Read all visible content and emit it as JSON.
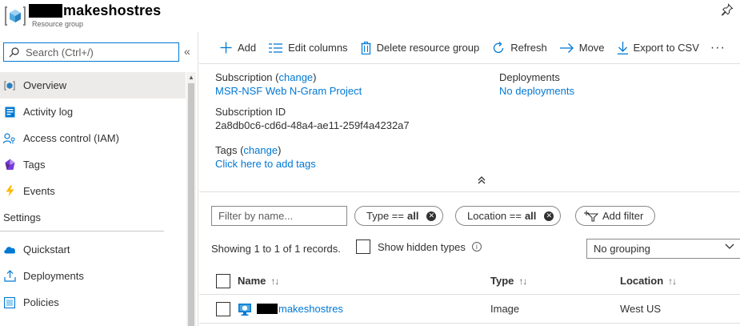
{
  "header": {
    "title": "makeshostres",
    "subtitle": "Resource group"
  },
  "sidebar": {
    "search": {
      "placeholder": "Search (Ctrl+/)",
      "value": ""
    },
    "collapse_label": "«",
    "items": [
      {
        "label": "Overview",
        "icon": "overview-icon",
        "active": true
      },
      {
        "label": "Activity log",
        "icon": "activity-log-icon"
      },
      {
        "label": "Access control (IAM)",
        "icon": "iam-icon"
      },
      {
        "label": "Tags",
        "icon": "tags-icon"
      },
      {
        "label": "Events",
        "icon": "events-icon"
      }
    ],
    "section": "Settings",
    "settings_items": [
      {
        "label": "Quickstart",
        "icon": "quickstart-icon"
      },
      {
        "label": "Deployments",
        "icon": "deployments-icon"
      },
      {
        "label": "Policies",
        "icon": "policies-icon"
      }
    ]
  },
  "toolbar": {
    "add": "Add",
    "edit_columns": "Edit columns",
    "delete": "Delete resource group",
    "refresh": "Refresh",
    "move": "Move",
    "export": "Export to CSV",
    "more": "···"
  },
  "essentials": {
    "subscription_label": "Subscription",
    "change": "change",
    "subscription_value": "MSR-NSF Web N-Gram Project",
    "subscription_id_label": "Subscription ID",
    "subscription_id_value": "2a8db0c6-cd6d-48a4-ae11-259f4a4232a7",
    "tags_label": "Tags",
    "tags_link": "Click here to add tags",
    "deployments_label": "Deployments",
    "deployments_value": "No deployments",
    "collapse_glyph": "⌃⌃"
  },
  "filters": {
    "name_placeholder": "Filter by name...",
    "type_pill": {
      "label": "Type ==",
      "value": "all"
    },
    "location_pill": {
      "label": "Location ==",
      "value": "all"
    },
    "add_filter": "Add filter"
  },
  "records": {
    "text": "Showing 1 to 1 of 1 records.",
    "show_hidden": "Show hidden types",
    "grouping": "No grouping"
  },
  "table": {
    "columns": {
      "name": "Name",
      "type": "Type",
      "location": "Location"
    },
    "rows": [
      {
        "name": "makeshostres",
        "type": "Image",
        "location": "West US"
      }
    ]
  },
  "colors": {
    "accent": "#0078d4",
    "text": "#323130",
    "border": "#8a8886"
  }
}
